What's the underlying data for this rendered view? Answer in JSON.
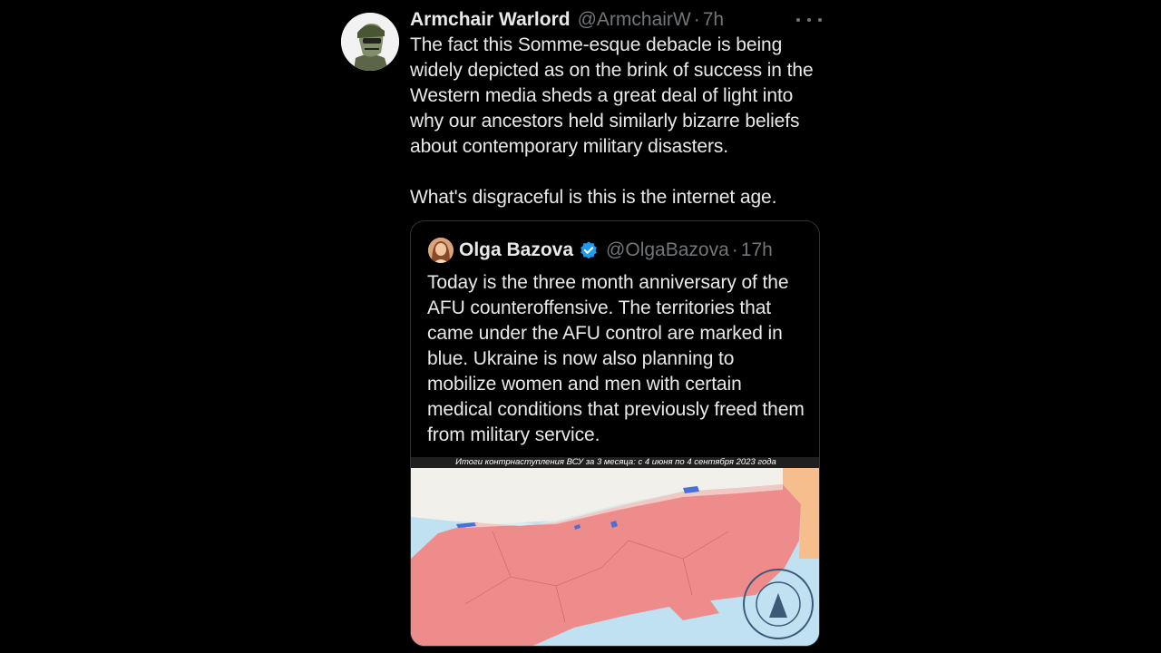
{
  "tweet": {
    "author_name": "Armchair Warlord",
    "handle": "@ArmchairW",
    "separator": "·",
    "time": "7h",
    "text": "The fact this Somme-esque debacle is being widely depicted as on the brink of success in the Western media sheds a great deal of light into why our ancestors held similarly bizarre beliefs about contemporary military disasters.\n\nWhat's disgraceful is this is the internet age."
  },
  "quoted_tweet": {
    "author_name": "Olga Bazova",
    "handle": "@OlgaBazova",
    "separator": "·",
    "time": "17h",
    "text": "Today is the three month anniversary of the AFU counteroffensive. The territories that came under the AFU control are marked in blue. Ukraine is now also planning to mobilize women and men with certain medical conditions that previously freed them from military service.",
    "map_caption": "Итоги контрнаступления ВСУ за 3 месяца: с 4 июня по 4 сентября 2023 года"
  },
  "colors": {
    "background": "#000000",
    "text": "#e7e9ea",
    "secondary": "#71767b",
    "verified": "#1d9bf0",
    "occupied": "#ee8c8c",
    "afu_gains": "#4a6fd8",
    "sea": "#bfe1f1"
  },
  "icons": [
    "more-icon",
    "verified-badge-icon"
  ]
}
